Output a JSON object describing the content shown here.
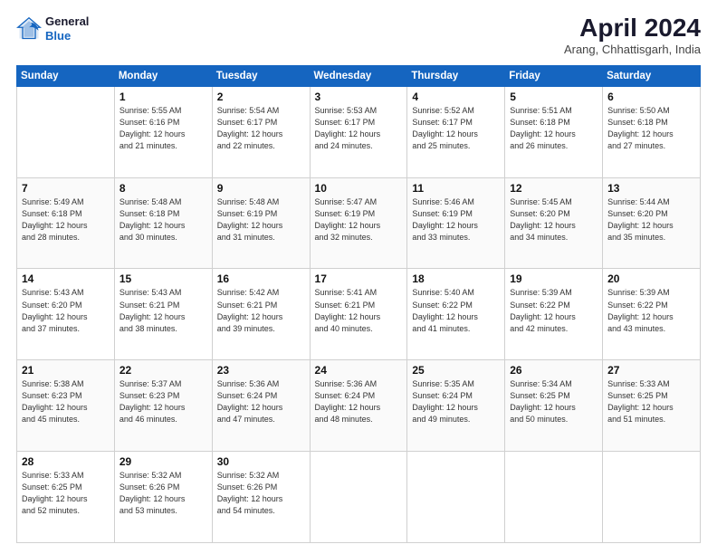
{
  "header": {
    "logo_line1": "General",
    "logo_line2": "Blue",
    "month_year": "April 2024",
    "location": "Arang, Chhattisgarh, India"
  },
  "days_of_week": [
    "Sunday",
    "Monday",
    "Tuesday",
    "Wednesday",
    "Thursday",
    "Friday",
    "Saturday"
  ],
  "weeks": [
    [
      {
        "day": "",
        "info": ""
      },
      {
        "day": "1",
        "info": "Sunrise: 5:55 AM\nSunset: 6:16 PM\nDaylight: 12 hours\nand 21 minutes."
      },
      {
        "day": "2",
        "info": "Sunrise: 5:54 AM\nSunset: 6:17 PM\nDaylight: 12 hours\nand 22 minutes."
      },
      {
        "day": "3",
        "info": "Sunrise: 5:53 AM\nSunset: 6:17 PM\nDaylight: 12 hours\nand 24 minutes."
      },
      {
        "day": "4",
        "info": "Sunrise: 5:52 AM\nSunset: 6:17 PM\nDaylight: 12 hours\nand 25 minutes."
      },
      {
        "day": "5",
        "info": "Sunrise: 5:51 AM\nSunset: 6:18 PM\nDaylight: 12 hours\nand 26 minutes."
      },
      {
        "day": "6",
        "info": "Sunrise: 5:50 AM\nSunset: 6:18 PM\nDaylight: 12 hours\nand 27 minutes."
      }
    ],
    [
      {
        "day": "7",
        "info": "Sunrise: 5:49 AM\nSunset: 6:18 PM\nDaylight: 12 hours\nand 28 minutes."
      },
      {
        "day": "8",
        "info": "Sunrise: 5:48 AM\nSunset: 6:18 PM\nDaylight: 12 hours\nand 30 minutes."
      },
      {
        "day": "9",
        "info": "Sunrise: 5:48 AM\nSunset: 6:19 PM\nDaylight: 12 hours\nand 31 minutes."
      },
      {
        "day": "10",
        "info": "Sunrise: 5:47 AM\nSunset: 6:19 PM\nDaylight: 12 hours\nand 32 minutes."
      },
      {
        "day": "11",
        "info": "Sunrise: 5:46 AM\nSunset: 6:19 PM\nDaylight: 12 hours\nand 33 minutes."
      },
      {
        "day": "12",
        "info": "Sunrise: 5:45 AM\nSunset: 6:20 PM\nDaylight: 12 hours\nand 34 minutes."
      },
      {
        "day": "13",
        "info": "Sunrise: 5:44 AM\nSunset: 6:20 PM\nDaylight: 12 hours\nand 35 minutes."
      }
    ],
    [
      {
        "day": "14",
        "info": "Sunrise: 5:43 AM\nSunset: 6:20 PM\nDaylight: 12 hours\nand 37 minutes."
      },
      {
        "day": "15",
        "info": "Sunrise: 5:43 AM\nSunset: 6:21 PM\nDaylight: 12 hours\nand 38 minutes."
      },
      {
        "day": "16",
        "info": "Sunrise: 5:42 AM\nSunset: 6:21 PM\nDaylight: 12 hours\nand 39 minutes."
      },
      {
        "day": "17",
        "info": "Sunrise: 5:41 AM\nSunset: 6:21 PM\nDaylight: 12 hours\nand 40 minutes."
      },
      {
        "day": "18",
        "info": "Sunrise: 5:40 AM\nSunset: 6:22 PM\nDaylight: 12 hours\nand 41 minutes."
      },
      {
        "day": "19",
        "info": "Sunrise: 5:39 AM\nSunset: 6:22 PM\nDaylight: 12 hours\nand 42 minutes."
      },
      {
        "day": "20",
        "info": "Sunrise: 5:39 AM\nSunset: 6:22 PM\nDaylight: 12 hours\nand 43 minutes."
      }
    ],
    [
      {
        "day": "21",
        "info": "Sunrise: 5:38 AM\nSunset: 6:23 PM\nDaylight: 12 hours\nand 45 minutes."
      },
      {
        "day": "22",
        "info": "Sunrise: 5:37 AM\nSunset: 6:23 PM\nDaylight: 12 hours\nand 46 minutes."
      },
      {
        "day": "23",
        "info": "Sunrise: 5:36 AM\nSunset: 6:24 PM\nDaylight: 12 hours\nand 47 minutes."
      },
      {
        "day": "24",
        "info": "Sunrise: 5:36 AM\nSunset: 6:24 PM\nDaylight: 12 hours\nand 48 minutes."
      },
      {
        "day": "25",
        "info": "Sunrise: 5:35 AM\nSunset: 6:24 PM\nDaylight: 12 hours\nand 49 minutes."
      },
      {
        "day": "26",
        "info": "Sunrise: 5:34 AM\nSunset: 6:25 PM\nDaylight: 12 hours\nand 50 minutes."
      },
      {
        "day": "27",
        "info": "Sunrise: 5:33 AM\nSunset: 6:25 PM\nDaylight: 12 hours\nand 51 minutes."
      }
    ],
    [
      {
        "day": "28",
        "info": "Sunrise: 5:33 AM\nSunset: 6:25 PM\nDaylight: 12 hours\nand 52 minutes."
      },
      {
        "day": "29",
        "info": "Sunrise: 5:32 AM\nSunset: 6:26 PM\nDaylight: 12 hours\nand 53 minutes."
      },
      {
        "day": "30",
        "info": "Sunrise: 5:32 AM\nSunset: 6:26 PM\nDaylight: 12 hours\nand 54 minutes."
      },
      {
        "day": "",
        "info": ""
      },
      {
        "day": "",
        "info": ""
      },
      {
        "day": "",
        "info": ""
      },
      {
        "day": "",
        "info": ""
      }
    ]
  ]
}
